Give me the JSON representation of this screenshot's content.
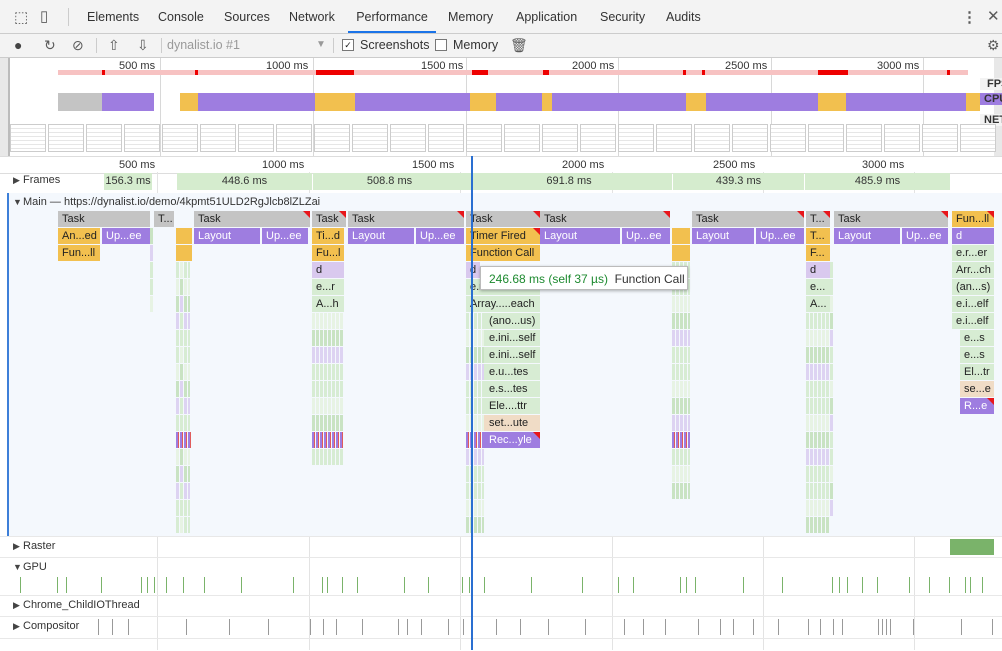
{
  "tabs": [
    {
      "label": "Elements"
    },
    {
      "label": "Console"
    },
    {
      "label": "Sources"
    },
    {
      "label": "Network"
    },
    {
      "label": "Performance"
    },
    {
      "label": "Memory"
    },
    {
      "label": "Application"
    },
    {
      "label": "Security"
    },
    {
      "label": "Audits"
    }
  ],
  "toolbar": {
    "profile_select": "dynalist.io #1",
    "screenshots_label": "Screenshots",
    "screenshots_checked": true,
    "memory_label": "Memory",
    "memory_checked": false
  },
  "overview": {
    "ticks": [
      "500 ms",
      "1000 ms",
      "1500 ms",
      "2000 ms",
      "2500 ms",
      "3000 ms"
    ],
    "lane_labels": {
      "fps": "FPS",
      "cpu": "CPU",
      "net": "NET"
    }
  },
  "timeline": {
    "ticks": [
      "500 ms",
      "1000 ms",
      "1500 ms",
      "2000 ms",
      "2500 ms",
      "3000 ms"
    ],
    "frames_label": "Frames",
    "frames": [
      "156.3 ms",
      "448.6 ms",
      "508.8 ms",
      "691.8 ms",
      "439.3 ms",
      "485.9 ms"
    ],
    "main_label": "Main — https://dynalist.io/demo/4kpmt51ULD2RgJlcb8lZLZai"
  },
  "flame": {
    "row1": [
      "Task",
      "T...",
      "Task",
      "Task",
      "Task",
      "Task",
      "Task",
      "Task",
      "T...",
      "Task",
      "Fun...ll"
    ],
    "row2": [
      "An...ed",
      "Up...ee",
      "Layout",
      "Up...ee",
      "Ti...d",
      "Layout",
      "Up...ee",
      "Timer Fired",
      "Layout",
      "Up...ee",
      "Layout",
      "Up...ee",
      "T...",
      "Layout",
      "Up...ee",
      "d"
    ],
    "row3": [
      "Fun...ll",
      "Fu...l",
      "Function Call",
      "F...",
      "e.r...er"
    ],
    "col_a": [
      "d",
      "e...r",
      "A...h"
    ],
    "col_b": [
      "d",
      "e.r...r",
      "Array.....each",
      "(ano...us)",
      "e.ini...self",
      "e.ini...self",
      "e.u...tes",
      "e.s...tes",
      "Ele....ttr",
      "set...ute",
      "Rec...yle"
    ],
    "col_c": [
      "d",
      "e...",
      "A..."
    ],
    "col_d": [
      "Arr...ch",
      "(an...s)",
      "e.i...elf",
      "e.i...elf",
      "e...s",
      "e...s",
      "El...tr",
      "se...e",
      "R...e"
    ]
  },
  "tooltip": {
    "duration": "246.68 ms (self 37 µs)",
    "name": "Function Call"
  },
  "tracks": [
    "Raster",
    "GPU",
    "Chrome_ChildIOThread",
    "Compositor"
  ]
}
